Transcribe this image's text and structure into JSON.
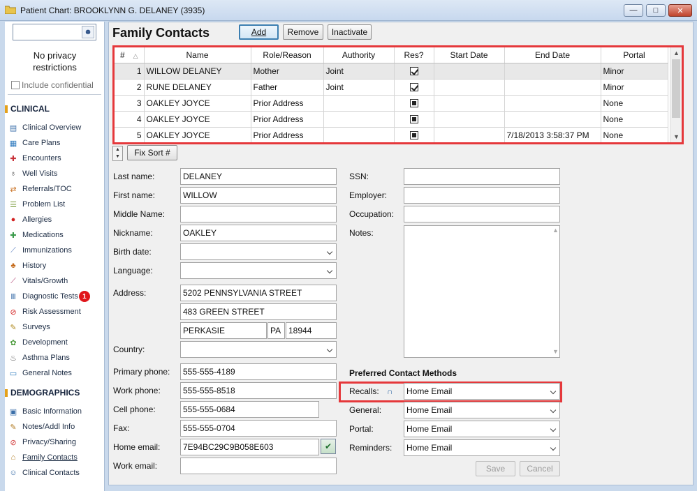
{
  "window": {
    "title": "Patient Chart: BROOKLYNN G. DELANEY (3935)",
    "min_glyph": "—",
    "max_glyph": "□",
    "close_glyph": "✕"
  },
  "sidebar": {
    "search_placeholder": "",
    "privacy_line1": "No privacy",
    "privacy_line2": "restrictions",
    "include_confidential": "Include confidential",
    "clinical_heading": "CLINICAL",
    "clinical_items": [
      {
        "label": "Clinical Overview",
        "icon": "overview-icon"
      },
      {
        "label": "Care Plans",
        "icon": "care-plans-icon"
      },
      {
        "label": "Encounters",
        "icon": "encounters-icon"
      },
      {
        "label": "Well Visits",
        "icon": "stethoscope-icon"
      },
      {
        "label": "Referrals/TOC",
        "icon": "referrals-icon"
      },
      {
        "label": "Problem List",
        "icon": "problem-list-icon"
      },
      {
        "label": "Allergies",
        "icon": "allergies-icon"
      },
      {
        "label": "Medications",
        "icon": "medications-icon"
      },
      {
        "label": "Immunizations",
        "icon": "syringe-icon"
      },
      {
        "label": "History",
        "icon": "family-tree-icon"
      },
      {
        "label": "Vitals/Growth",
        "icon": "growth-chart-icon"
      },
      {
        "label": "Diagnostic Tests",
        "icon": "test-tubes-icon",
        "badge": "1"
      },
      {
        "label": "Risk Assessment",
        "icon": "risk-icon"
      },
      {
        "label": "Surveys",
        "icon": "surveys-icon"
      },
      {
        "label": "Development",
        "icon": "development-icon"
      },
      {
        "label": "Asthma Plans",
        "icon": "asthma-icon"
      },
      {
        "label": "General Notes",
        "icon": "notes-icon"
      }
    ],
    "demographics_heading": "DEMOGRAPHICS",
    "demographics_items": [
      {
        "label": "Basic Information",
        "icon": "id-card-icon"
      },
      {
        "label": "Notes/Addl Info",
        "icon": "notepad-icon"
      },
      {
        "label": "Privacy/Sharing",
        "icon": "privacy-icon"
      },
      {
        "label": "Family Contacts",
        "icon": "family-icon",
        "active": true
      },
      {
        "label": "Clinical Contacts",
        "icon": "clinical-contacts-icon"
      }
    ]
  },
  "main": {
    "title": "Family Contacts",
    "buttons": {
      "add": "Add",
      "remove": "Remove",
      "inactivate": "Inactivate",
      "fix_sort": "Fix Sort #",
      "save": "Save",
      "cancel": "Cancel"
    },
    "grid": {
      "columns": [
        "#",
        "Name",
        "Role/Reason",
        "Authority",
        "Res?",
        "Start Date",
        "End Date",
        "Portal"
      ],
      "sort_indicator": "△",
      "rows": [
        {
          "num": "1",
          "name": "WILLOW  DELANEY",
          "role": "Mother",
          "authority": "Joint",
          "res": "checked",
          "start": "",
          "end": "",
          "portal": "Minor"
        },
        {
          "num": "2",
          "name": "RUNE  DELANEY",
          "role": "Father",
          "authority": "Joint",
          "res": "checked",
          "start": "",
          "end": "",
          "portal": "Minor"
        },
        {
          "num": "3",
          "name": "OAKLEY  JOYCE",
          "role": "Prior Address",
          "authority": "",
          "res": "filled",
          "start": "",
          "end": "",
          "portal": "None"
        },
        {
          "num": "4",
          "name": "OAKLEY  JOYCE",
          "role": "Prior Address",
          "authority": "",
          "res": "filled",
          "start": "",
          "end": "",
          "portal": "None"
        },
        {
          "num": "5",
          "name": "OAKLEY  JOYCE",
          "role": "Prior Address",
          "authority": "",
          "res": "filled",
          "start": "",
          "end": "7/18/2013 3:58:37 PM",
          "portal": "None"
        }
      ]
    },
    "form": {
      "last_name": {
        "label": "Last name:",
        "value": "DELANEY"
      },
      "first_name": {
        "label": "First name:",
        "value": "WILLOW"
      },
      "middle_name": {
        "label": "Middle Name:",
        "value": ""
      },
      "nickname": {
        "label": "Nickname:",
        "value": "OAKLEY"
      },
      "birth_date": {
        "label": "Birth date:",
        "value": ""
      },
      "language": {
        "label": "Language:",
        "value": ""
      },
      "address": {
        "label": "Address:",
        "line1": "5202 PENNSYLVANIA STREET",
        "line2": "483 GREEN STREET",
        "city": "PERKASIE",
        "state": "PA",
        "zip": "18944"
      },
      "country": {
        "label": "Country:",
        "value": ""
      },
      "primary_phone": {
        "label": "Primary phone:",
        "value": "555-555-4189"
      },
      "work_phone": {
        "label": "Work phone:",
        "value": "555-555-8518"
      },
      "cell_phone": {
        "label": "Cell phone:",
        "value": "555-555-0684"
      },
      "fax": {
        "label": "Fax:",
        "value": "555-555-0704"
      },
      "home_email": {
        "label": "Home email:",
        "value": "7E94BC29C9B058E603"
      },
      "work_email": {
        "label": "Work email:",
        "value": ""
      },
      "ssn": {
        "label": "SSN:",
        "value": ""
      },
      "employer": {
        "label": "Employer:",
        "value": ""
      },
      "occupation": {
        "label": "Occupation:",
        "value": ""
      },
      "notes": {
        "label": "Notes:",
        "value": ""
      }
    },
    "preferred_contact": {
      "title": "Preferred Contact Methods",
      "recalls": {
        "label": "Recalls:",
        "value": "Home Email"
      },
      "general": {
        "label": "General:",
        "value": "Home Email"
      },
      "portal": {
        "label": "Portal:",
        "value": "Home Email"
      },
      "reminders": {
        "label": "Reminders:",
        "value": "Home Email"
      }
    }
  },
  "colors": {
    "highlight_border": "#e5383b",
    "badge": "#e0161b",
    "section_accent": "#e4a11b"
  }
}
